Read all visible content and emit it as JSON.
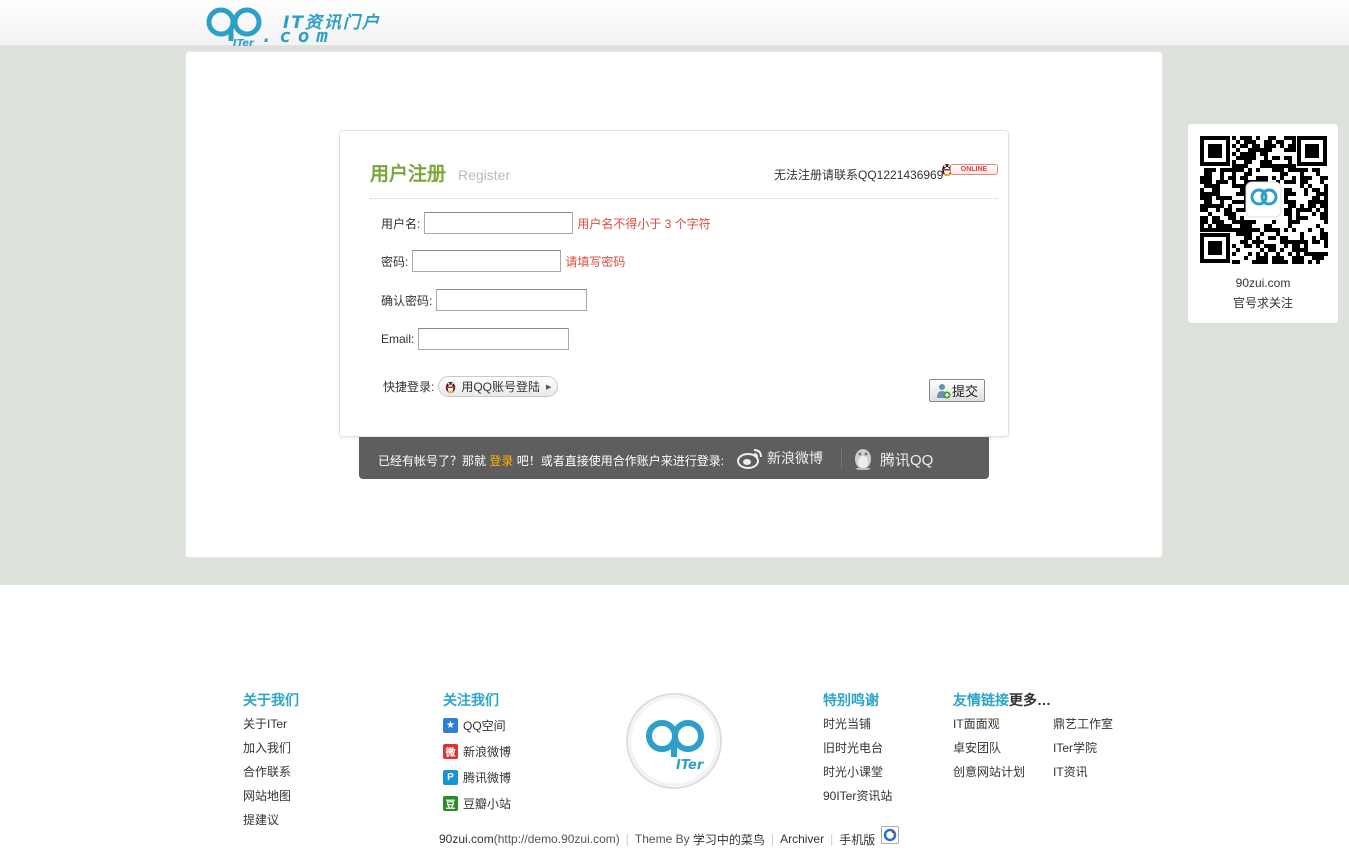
{
  "header": {
    "logo_tagline": "IT资讯门户",
    "logo_domain": ".com",
    "logo_mark": "ITer"
  },
  "register": {
    "title": "用户注册",
    "subtitle": "Register",
    "contact_text": "无法注册请联系QQ1221436969",
    "online_badge": "ONLINE",
    "fields": {
      "username": {
        "label": "用户名:",
        "value": "",
        "hint": "用户名不得小于 3 个字符"
      },
      "password": {
        "label": "密码:",
        "value": "",
        "hint": "请填写密码"
      },
      "confirm": {
        "label": "确认密码:",
        "value": ""
      },
      "email": {
        "label": "Email:",
        "value": ""
      }
    },
    "quick_login_label": "快捷登录:",
    "qq_login_button": "用QQ账号登陆",
    "submit_label": "提交"
  },
  "other_login": {
    "prefix": "已经有帐号了？那就",
    "login_link": "登录",
    "suffix": "吧！或者直接使用合作账户来进行登录:",
    "weibo": "新浪微博",
    "tqq": "腾讯QQ"
  },
  "qr": {
    "site": "90zui.com",
    "follow": "官号求关注"
  },
  "footer": {
    "about": {
      "title": "关于我们",
      "links": [
        "关于ITer",
        "加入我们",
        "合作联系",
        "网站地图",
        "提建议"
      ]
    },
    "follow": {
      "title": "关注我们",
      "links": [
        {
          "label": "QQ空间",
          "icon": "qzone-icon",
          "color": "#2b7fd6"
        },
        {
          "label": "新浪微博",
          "icon": "weibo-icon",
          "color": "#e0332f"
        },
        {
          "label": "腾讯微博",
          "icon": "tencent-weibo-icon",
          "color": "#1a93d4"
        },
        {
          "label": "豆瓣小站",
          "icon": "douban-icon",
          "color": "#2b8a2b"
        }
      ]
    },
    "thanks": {
      "title": "特别鸣谢",
      "links": [
        "时光当铺",
        "旧时光电台",
        "时光小课堂",
        "90ITer资讯站"
      ]
    },
    "friends": {
      "title": "友情链接",
      "more": "更多…",
      "links_col1": [
        "IT面面观",
        "卓安团队",
        "创意网站计划"
      ],
      "links_col2": [
        "鼎艺工作室",
        "ITer学院",
        "IT资讯"
      ]
    },
    "copyright": {
      "site": "90zui.com",
      "url": "(http://demo.90zui.com)",
      "theme_prefix": "Theme By",
      "theme_author": "学习中的菜鸟",
      "archiver": "Archiver",
      "mobile": "手机版"
    }
  },
  "colors": {
    "accent_green": "#7aa63a",
    "footer_heading": "#2da5c6",
    "hint_red": "#e04a3c",
    "band_bg": "#dde3da"
  }
}
